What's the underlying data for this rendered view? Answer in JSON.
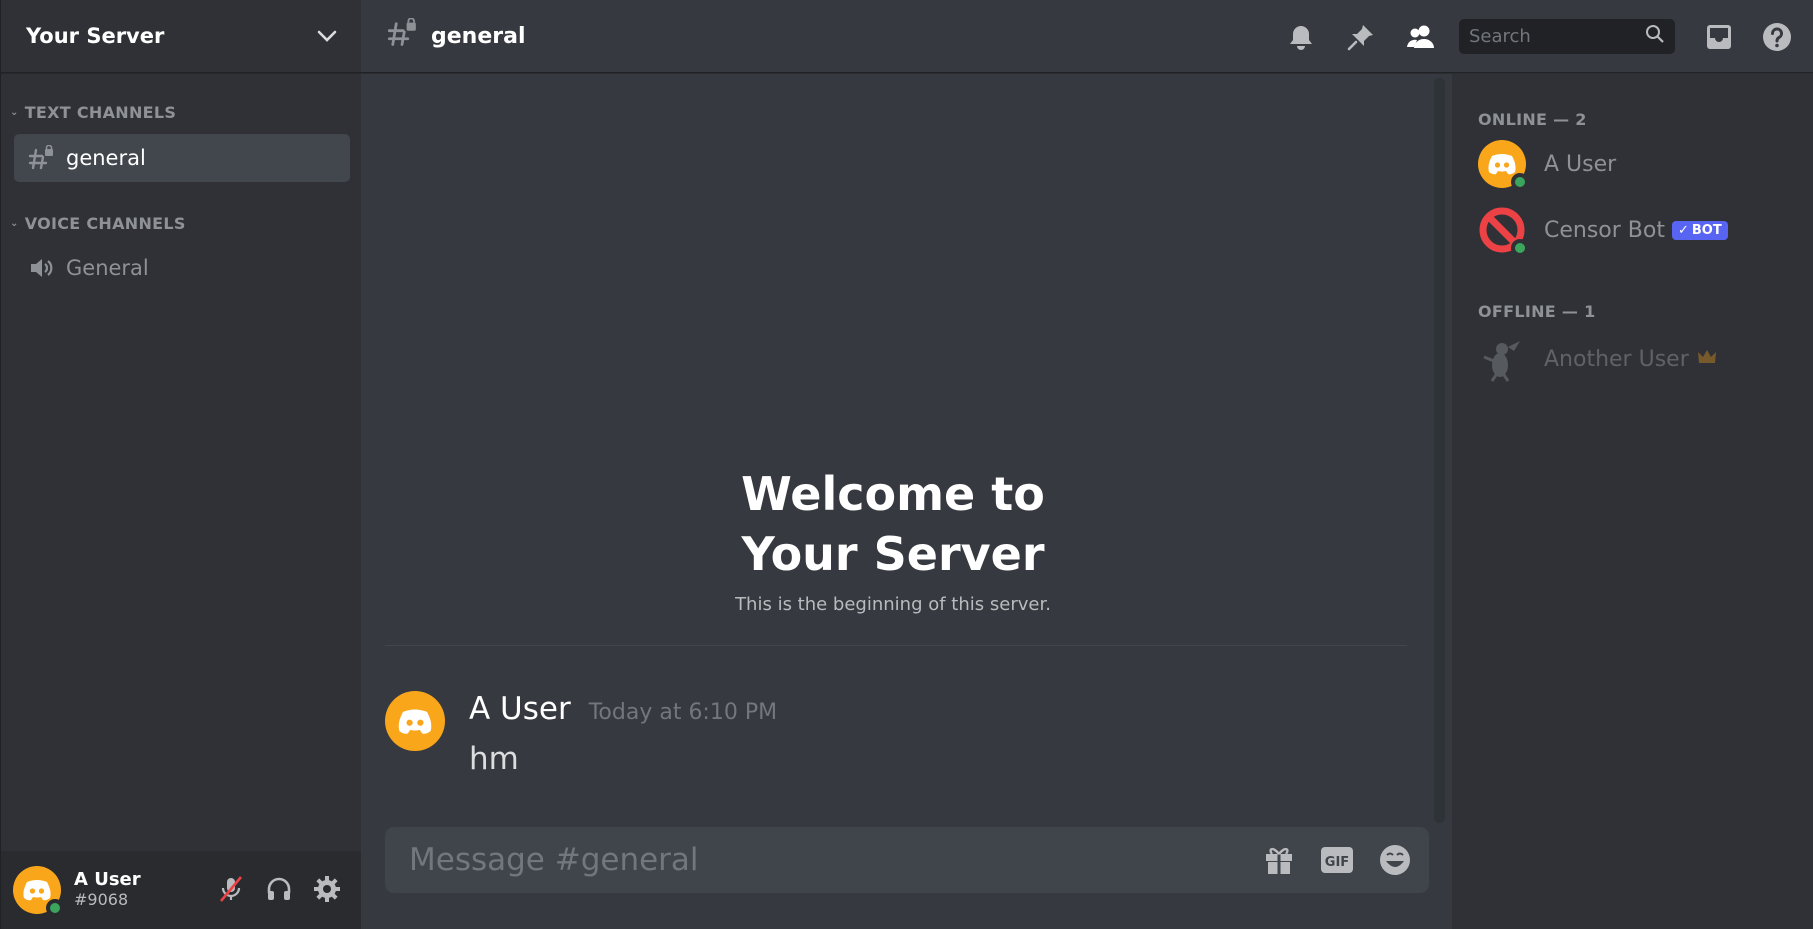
{
  "server": {
    "name": "Your Server"
  },
  "sidebar": {
    "categories": [
      {
        "label": "TEXT CHANNELS"
      },
      {
        "label": "VOICE CHANNELS"
      }
    ],
    "channels": [
      {
        "name": "general",
        "type": "text",
        "active": true
      },
      {
        "name": "General",
        "type": "voice",
        "active": false
      }
    ]
  },
  "user_panel": {
    "name": "A User",
    "tag": "#9068"
  },
  "header": {
    "channel": "general",
    "search_placeholder": "Search"
  },
  "welcome": {
    "title_line1": "Welcome to",
    "title_line2": "Your Server",
    "subtitle": "This is the beginning of this server."
  },
  "messages": [
    {
      "author": "A User",
      "time": "Today at 6:10 PM",
      "text": "hm"
    }
  ],
  "composer": {
    "placeholder": "Message #general",
    "gif_label": "GIF"
  },
  "members": {
    "online_label": "ONLINE — 2",
    "offline_label": "OFFLINE — 1",
    "online": [
      {
        "name": "A User"
      },
      {
        "name": "Censor Bot",
        "badge": "BOT"
      }
    ],
    "offline": [
      {
        "name": "Another User"
      }
    ]
  },
  "colors": {
    "accent": "#5865f2",
    "online": "#3ba55d",
    "avatar_orange": "#faa61a",
    "bot_red": "#ed4245",
    "crown": "#faa61a"
  }
}
